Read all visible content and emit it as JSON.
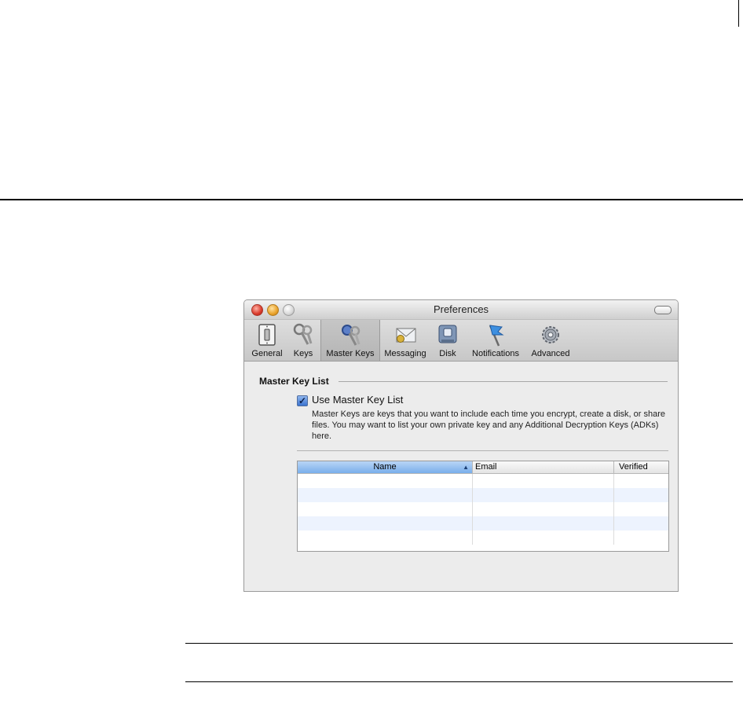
{
  "window": {
    "title": "Preferences"
  },
  "toolbar": {
    "items": [
      {
        "label": "General",
        "icon": "light-switch-icon"
      },
      {
        "label": "Keys",
        "icon": "keys-icon"
      },
      {
        "label": "Master Keys",
        "icon": "master-keys-icon",
        "selected": true
      },
      {
        "label": "Messaging",
        "icon": "envelope-icon"
      },
      {
        "label": "Disk",
        "icon": "disk-icon"
      },
      {
        "label": "Notifications",
        "icon": "flag-icon"
      },
      {
        "label": "Advanced",
        "icon": "gear-icon"
      }
    ]
  },
  "master_key": {
    "section_title": "Master Key List",
    "checkbox_label": "Use Master Key List",
    "checkbox_checked": true,
    "description": "Master Keys are keys that you want to include each time you encrypt, create a disk, or share files. You may want to list your own private key and any Additional Decryption Keys (ADKs) here.",
    "table": {
      "columns": [
        "Name",
        "Email",
        "Verified"
      ],
      "sorted_column": "Name",
      "rows": []
    },
    "add_label": "+",
    "remove_label": "−",
    "help_label": "?"
  },
  "colors": {
    "accent": "#3a73cf",
    "sorted_header": "#79aeeb",
    "alt_row": "#edf3fe"
  }
}
